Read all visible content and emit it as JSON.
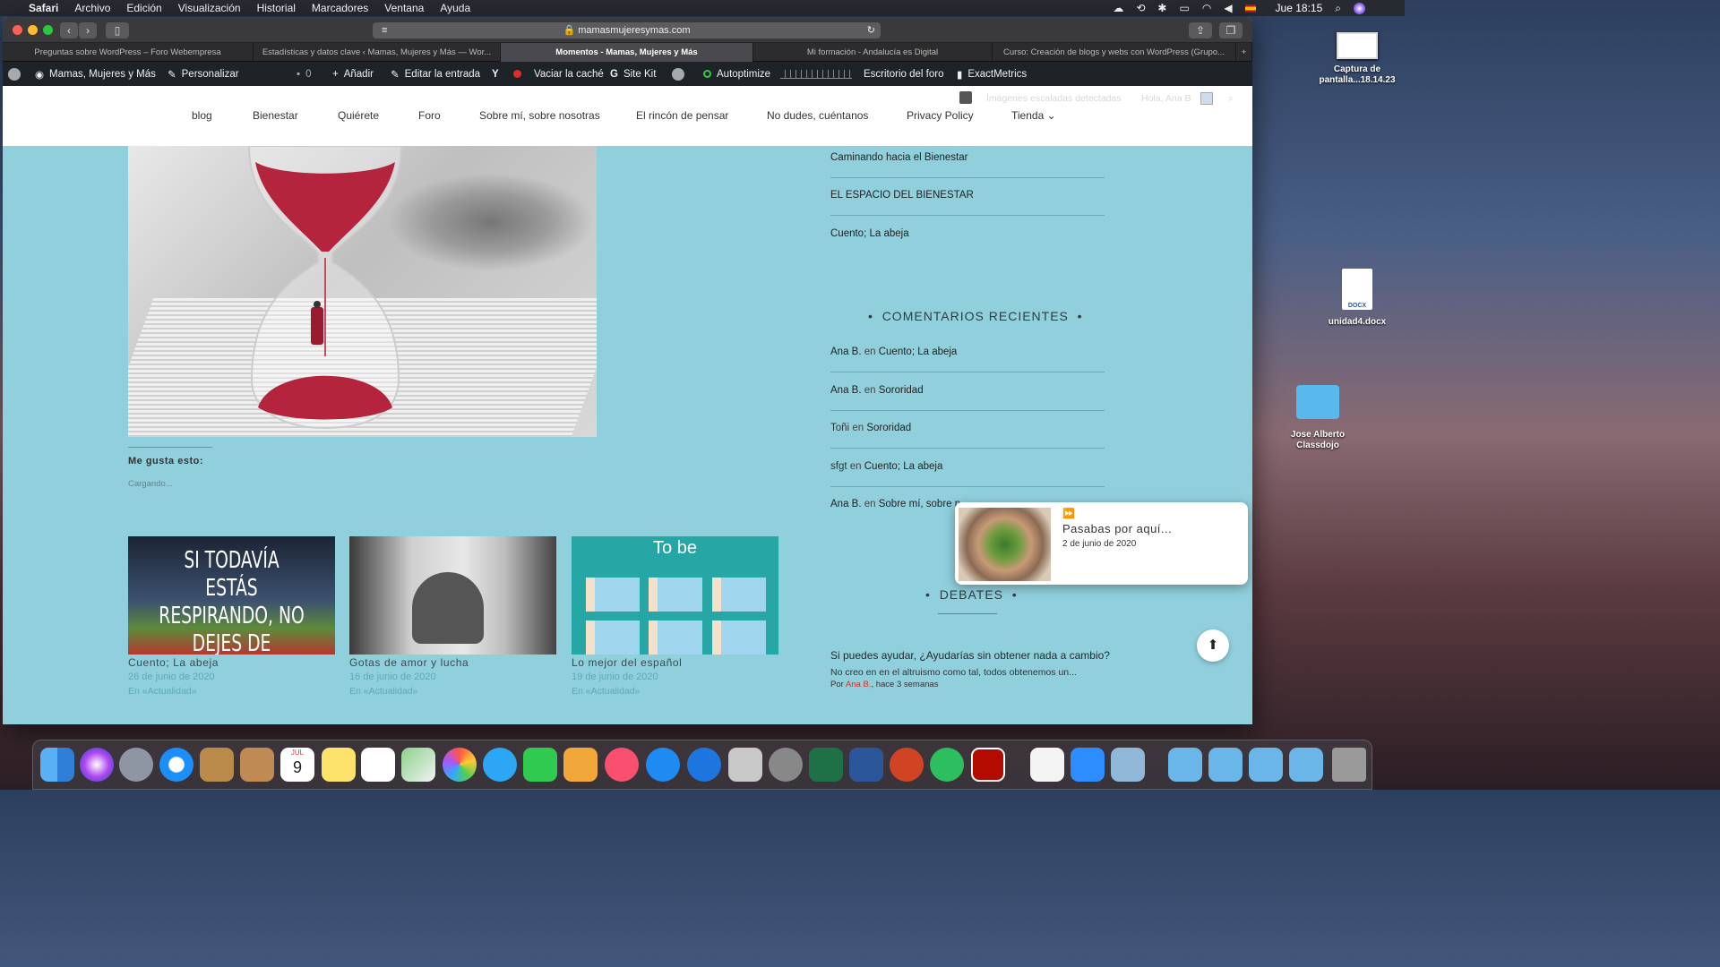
{
  "menubar": {
    "app": "Safari",
    "items": [
      "Archivo",
      "Edición",
      "Visualización",
      "Historial",
      "Marcadores",
      "Ventana",
      "Ayuda"
    ],
    "clock": "Jue 18:15"
  },
  "browser": {
    "url": "mamasmujeresymas.com",
    "tabs": [
      "Preguntas sobre WordPress – Foro Webempresa",
      "Estadísticas y datos clave ‹ Mamas, Mujeres y Más — Wor...",
      "Momentos - Mamas, Mujeres y Más",
      "Mi formación - Andalucía es Digital",
      "Curso: Creación de blogs y webs con WordPress (Grupo..."
    ]
  },
  "adminbar": {
    "site": "Mamas, Mujeres y Más",
    "customize": "Personalizar",
    "comments": "0",
    "add": "Añadir",
    "edit": "Editar la entrada",
    "cache": "Vaciar la caché",
    "sitekit": "Site Kit",
    "autoptimize": "Autoptimize",
    "forum": "Escritorio del foro",
    "metrics": "ExactMetrics"
  },
  "header": {
    "nav": [
      "blog",
      "Bienestar",
      "Quiérete",
      "Foro",
      "Sobre mí, sobre nosotras",
      "El rincón de pensar",
      "No dudes, cuéntanos",
      "Privacy Policy",
      "Tienda"
    ],
    "scaled": "Imágenes escaladas detectadas",
    "hello": "Hola, Ana B"
  },
  "post": {
    "like_title": "Me gusta esto:",
    "loading": "Cargando...",
    "related": [
      {
        "title": "Cuento; La abeja",
        "date": "26 de junio de 2020",
        "cat": "En «Actualidad»",
        "img_text": "SI TODAVÍA ESTÁS RESPIRANDO, NO DEJES DE APRENDER."
      },
      {
        "title": "Gotas de amor y lucha",
        "date": "16 de junio de 2020",
        "cat": "En «Actualidad»"
      },
      {
        "title": "Lo mejor del español",
        "date": "19 de junio de 2020",
        "cat": "En «Actualidad»",
        "img_text": "To be"
      }
    ]
  },
  "sidebar": {
    "recent_posts": [
      "Caminando hacia el Bienestar",
      "EL ESPACIO DEL BIENESTAR",
      "Cuento; La abeja"
    ],
    "comments_title": "COMENTARIOS RECIENTES",
    "comments": [
      {
        "author": "Ana B.",
        "on": "en",
        "post": "Cuento; La abeja"
      },
      {
        "author": "Ana B.",
        "on": "en",
        "post": "Sororidad"
      },
      {
        "author": "Toñi",
        "on": "en",
        "post": "Sororidad"
      },
      {
        "author": "sfgt",
        "on": "en",
        "post": "Cuento; La abeja"
      },
      {
        "author": "Ana B.",
        "on": "en",
        "post": "Sobre mí, sobre n"
      }
    ],
    "debates_title": "DEBATES",
    "debate": {
      "title": "Si puedes ayudar, ¿Ayudarías sin obtener nada a cambio?",
      "excerpt": "No creo en en el altruismo como tal, todos obtenemos un...",
      "by": "Por",
      "author": "Ana B.",
      "when": ", hace 3 semanas"
    }
  },
  "popup": {
    "title": "Pasabas por aquí...",
    "date": "2 de junio de 2020"
  },
  "desktop": {
    "icons": [
      "Captura de pantalla...18.14.23",
      "unidad4.docx",
      "Jose Alberto Classdojo"
    ],
    "doc_badge": "DOCX"
  },
  "dock": {
    "calendar_month": "JUL",
    "calendar_day": "9"
  }
}
